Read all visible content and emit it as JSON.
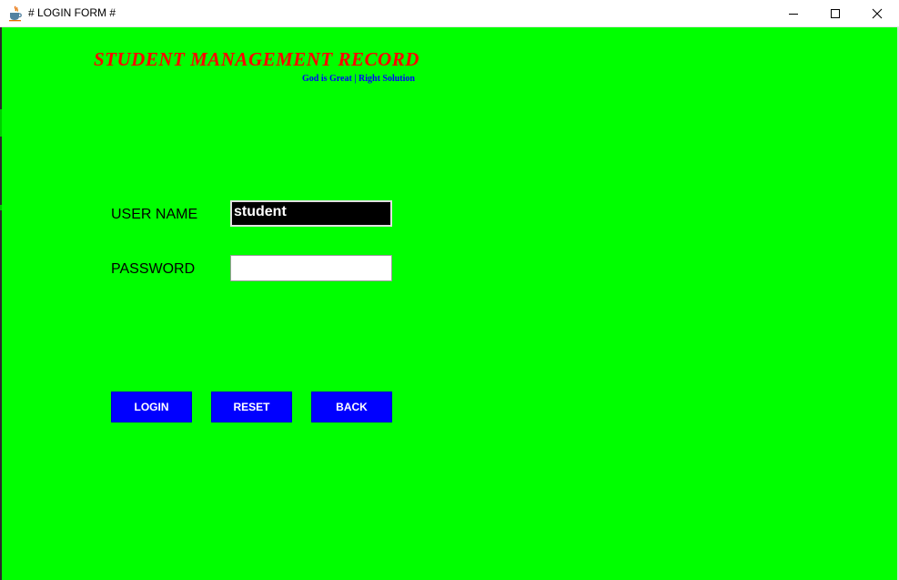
{
  "window": {
    "title": "# LOGIN FORM #",
    "icon": "java-coffee-icon",
    "controls": [
      "minimize-icon",
      "maximize-icon",
      "close-icon"
    ]
  },
  "header": {
    "title": "STUDENT MANAGEMENT RECORD",
    "subtitle": "God is Great | Right Solution"
  },
  "form": {
    "username_label": "USER NAME",
    "username_value": "student",
    "password_label": "PASSWORD",
    "password_value": ""
  },
  "buttons": {
    "login": "LOGIN",
    "reset": "RESET",
    "back": "BACK"
  },
  "colors": {
    "background": "#00ff00",
    "title": "#ff0000",
    "subtitle": "#0000ff",
    "button": "#0000ff",
    "button_text": "#ffffff",
    "username_field_bg": "#000000"
  }
}
